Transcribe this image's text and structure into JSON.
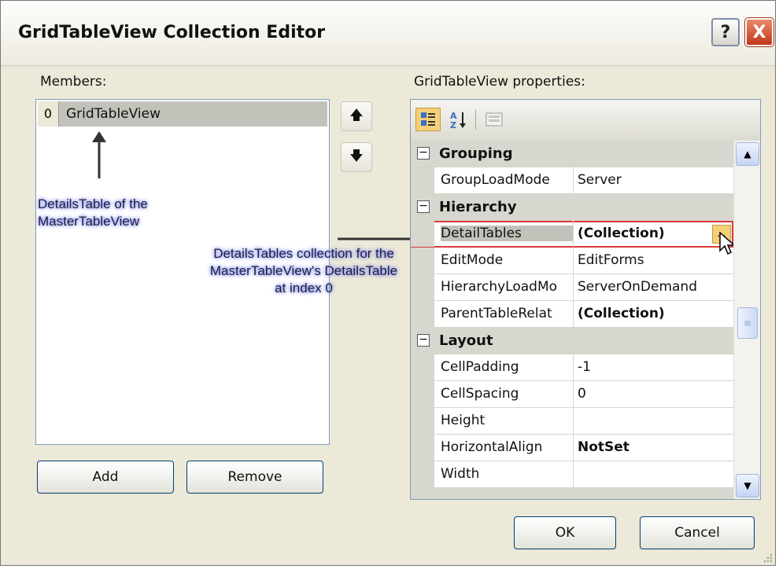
{
  "window": {
    "title": "GridTableView Collection Editor",
    "help_label": "?",
    "close_label": "X"
  },
  "members": {
    "label": "Members:",
    "items": [
      {
        "index": "0",
        "name": "GridTableView"
      }
    ],
    "add_label": "Add",
    "remove_label": "Remove",
    "up_glyph": "🡅",
    "down_glyph": "🡇"
  },
  "annotations": {
    "details_table": "DetailsTable of the MasterTableView",
    "details_tables_collection": "DetailsTables collection for the MasterTableView's DetailsTable at index 0"
  },
  "properties": {
    "label": "GridTableView properties:",
    "toolbar_icons": [
      "categorized-icon",
      "alphabetical-icon",
      "property-pages-icon"
    ],
    "categories": [
      {
        "name": "Grouping",
        "toggle": "⊟",
        "rows": [
          {
            "name": "GroupLoadMode",
            "value": "Server",
            "bold": false
          }
        ]
      },
      {
        "name": "Hierarchy",
        "toggle": "⊟",
        "rows": [
          {
            "name": "DetailTables",
            "value": "(Collection)",
            "bold": true,
            "selected": true
          },
          {
            "name": "EditMode",
            "value": "EditForms",
            "bold": false
          },
          {
            "name": "HierarchyLoadMo",
            "value": "ServerOnDemand",
            "bold": false
          },
          {
            "name": "ParentTableRelat",
            "value": "(Collection)",
            "bold": true
          }
        ]
      },
      {
        "name": "Layout",
        "toggle": "⊟",
        "rows": [
          {
            "name": "CellPadding",
            "value": "-1",
            "bold": false
          },
          {
            "name": "CellSpacing",
            "value": "0",
            "bold": false
          },
          {
            "name": "Height",
            "value": "",
            "bold": false
          },
          {
            "name": "HorizontalAlign",
            "value": "NotSet",
            "bold": true
          },
          {
            "name": "Width",
            "value": "",
            "bold": false
          }
        ]
      }
    ],
    "ellipsis_label": "...",
    "scroll_up_glyph": "▲",
    "scroll_down_glyph": "▼",
    "scroll_thumb_glyph": "≡"
  },
  "footer": {
    "ok_label": "OK",
    "cancel_label": "Cancel"
  },
  "colors": {
    "dialog_bg": "#ece9d8",
    "selection_outline": "#d93a3a",
    "annotation_glow": "#6f7bff"
  }
}
